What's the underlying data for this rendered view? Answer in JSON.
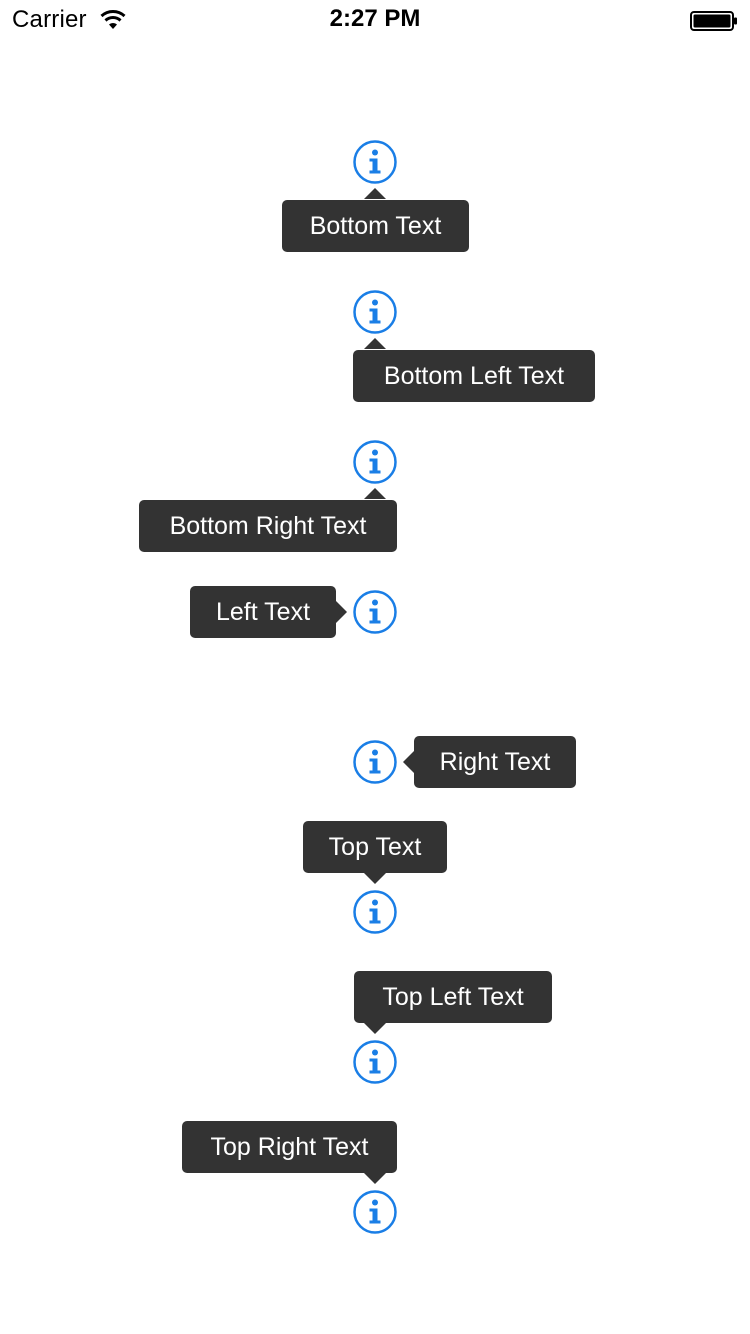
{
  "status_bar": {
    "carrier": "Carrier",
    "time": "2:27 PM"
  },
  "accent_color": "#1a7ee6",
  "tooltip_color": "#333333",
  "tooltips": {
    "bottom": "Bottom Text",
    "bottom_left": "Bottom Left Text",
    "bottom_right": "Bottom Right Text",
    "left": "Left Text",
    "right": "Right Text",
    "top": "Top Text",
    "top_left": "Top Left Text",
    "top_right": "Top Right Text"
  }
}
